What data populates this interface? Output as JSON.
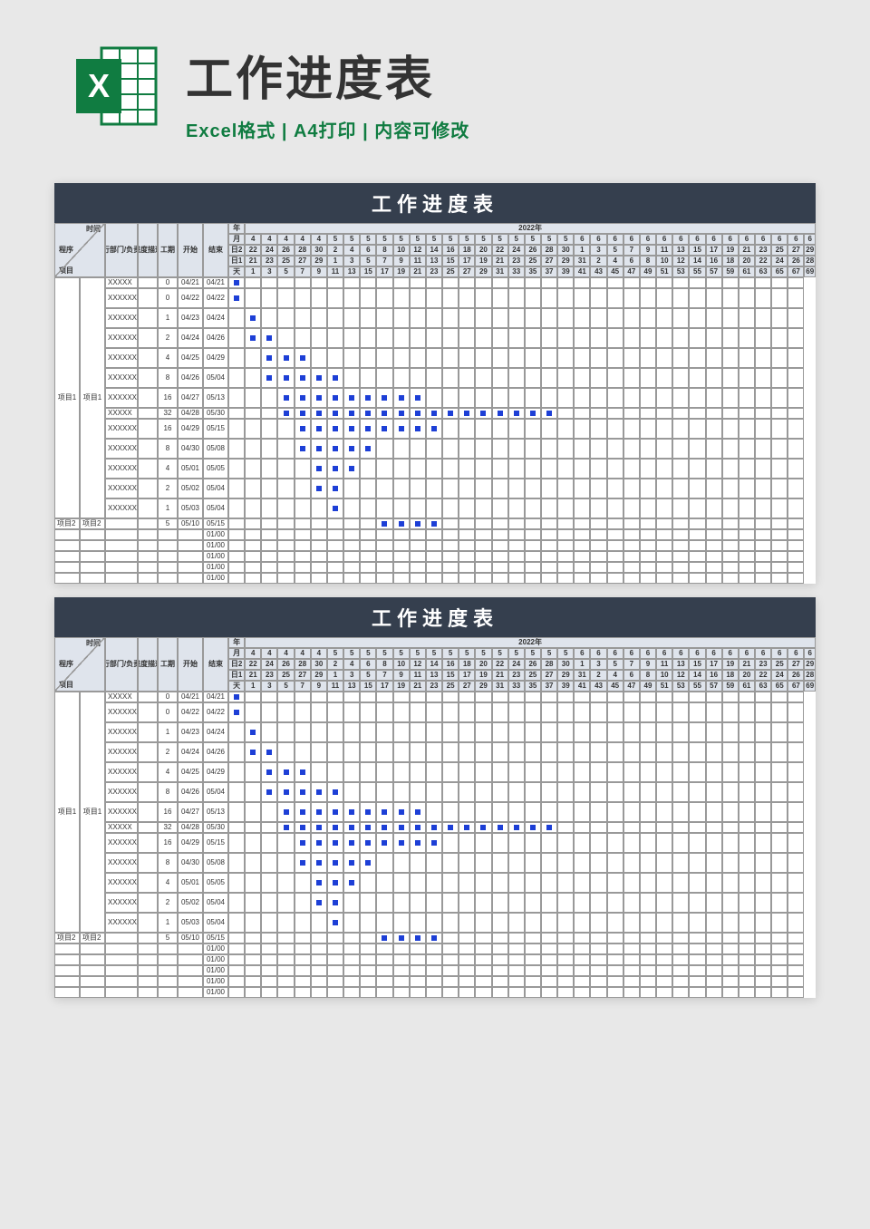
{
  "header": {
    "title": "工作进度表",
    "subtitle": "Excel格式 | A4打印 | 内容可修改"
  },
  "sheet": {
    "banner": "工作进度表",
    "cornerTop": "时间",
    "cornerBottom": "项目",
    "labels": {
      "process": "程序",
      "dept": "执行部门/负责人",
      "progress": "进度描述",
      "duration": "工期",
      "start": "开始",
      "end": "结束",
      "year": "年",
      "yearVal": "2022年",
      "month": "月",
      "date1": "日2",
      "date2": "日1",
      "day": "天"
    },
    "monthRow": [
      "4",
      "4",
      "4",
      "4",
      "4",
      "5",
      "5",
      "5",
      "5",
      "5",
      "5",
      "5",
      "5",
      "5",
      "5",
      "5",
      "5",
      "5",
      "5",
      "5",
      "6",
      "6",
      "6",
      "6",
      "6",
      "6",
      "6",
      "6",
      "6",
      "6",
      "6",
      "6",
      "6",
      "6",
      "6"
    ],
    "date2Row": [
      "22",
      "24",
      "26",
      "28",
      "30",
      "2",
      "4",
      "6",
      "8",
      "10",
      "12",
      "14",
      "16",
      "18",
      "20",
      "22",
      "24",
      "26",
      "28",
      "30",
      "1",
      "3",
      "5",
      "7",
      "9",
      "11",
      "13",
      "15",
      "17",
      "19",
      "21",
      "23",
      "25",
      "27",
      "29"
    ],
    "date1Row": [
      "21",
      "23",
      "25",
      "27",
      "29",
      "1",
      "3",
      "5",
      "7",
      "9",
      "11",
      "13",
      "15",
      "17",
      "19",
      "21",
      "23",
      "25",
      "27",
      "29",
      "31",
      "2",
      "4",
      "6",
      "8",
      "10",
      "12",
      "14",
      "16",
      "18",
      "20",
      "22",
      "24",
      "26",
      "28"
    ],
    "dayRow": [
      "1",
      "3",
      "5",
      "7",
      "9",
      "11",
      "13",
      "15",
      "17",
      "19",
      "21",
      "23",
      "25",
      "27",
      "29",
      "31",
      "33",
      "35",
      "37",
      "39",
      "41",
      "43",
      "45",
      "47",
      "49",
      "51",
      "53",
      "55",
      "57",
      "59",
      "61",
      "63",
      "65",
      "67",
      "69"
    ],
    "rows": [
      {
        "proc": "",
        "proj": "",
        "dept": "XXXXX",
        "dur": "0",
        "start": "04/21",
        "end": "04/21",
        "bars": [
          0
        ]
      },
      {
        "proc": "",
        "proj": "",
        "dept": "XXXXXX",
        "dur": "0",
        "start": "04/22",
        "end": "04/22",
        "bars": [
          0
        ]
      },
      {
        "proc": "",
        "proj": "",
        "dept": "XXXXXX",
        "dur": "1",
        "start": "04/23",
        "end": "04/24",
        "bars": [
          1
        ]
      },
      {
        "proc": "",
        "proj": "",
        "dept": "XXXXXX",
        "dur": "2",
        "start": "04/24",
        "end": "04/26",
        "bars": [
          1,
          2
        ]
      },
      {
        "proc": "",
        "proj": "",
        "dept": "XXXXXX",
        "dur": "4",
        "start": "04/25",
        "end": "04/29",
        "bars": [
          2,
          3,
          4
        ]
      },
      {
        "proc": "",
        "proj": "",
        "dept": "XXXXXX",
        "dur": "8",
        "start": "04/26",
        "end": "05/04",
        "bars": [
          2,
          3,
          4,
          5,
          6
        ]
      },
      {
        "proc": "项目1",
        "proj": "项目1",
        "dept": "XXXXXX",
        "dur": "16",
        "start": "04/27",
        "end": "05/13",
        "bars": [
          3,
          4,
          5,
          6,
          7,
          8,
          9,
          10,
          11
        ]
      },
      {
        "proc": "",
        "proj": "",
        "dept": "XXXXX",
        "dur": "32",
        "start": "04/28",
        "end": "05/30",
        "bars": [
          3,
          4,
          5,
          6,
          7,
          8,
          9,
          10,
          11,
          12,
          13,
          14,
          15,
          16,
          17,
          18,
          19
        ]
      },
      {
        "proc": "",
        "proj": "",
        "dept": "XXXXXX",
        "dur": "16",
        "start": "04/29",
        "end": "05/15",
        "bars": [
          4,
          5,
          6,
          7,
          8,
          9,
          10,
          11,
          12
        ]
      },
      {
        "proc": "",
        "proj": "",
        "dept": "XXXXXX",
        "dur": "8",
        "start": "04/30",
        "end": "05/08",
        "bars": [
          4,
          5,
          6,
          7,
          8
        ]
      },
      {
        "proc": "",
        "proj": "",
        "dept": "XXXXXX",
        "dur": "4",
        "start": "05/01",
        "end": "05/05",
        "bars": [
          5,
          6,
          7
        ]
      },
      {
        "proc": "",
        "proj": "",
        "dept": "XXXXXX",
        "dur": "2",
        "start": "05/02",
        "end": "05/04",
        "bars": [
          5,
          6
        ]
      },
      {
        "proc": "",
        "proj": "",
        "dept": "XXXXXX",
        "dur": "1",
        "start": "05/03",
        "end": "05/04",
        "bars": [
          6
        ]
      },
      {
        "proc": "项目2",
        "proj": "项目2",
        "dept": "",
        "dur": "5",
        "start": "05/10",
        "end": "05/15",
        "bars": [
          9,
          10,
          11,
          12
        ]
      },
      {
        "proc": "",
        "proj": "",
        "dept": "",
        "dur": "",
        "start": "",
        "end": "01/00",
        "bars": []
      },
      {
        "proc": "",
        "proj": "",
        "dept": "",
        "dur": "",
        "start": "",
        "end": "01/00",
        "bars": []
      },
      {
        "proc": "",
        "proj": "",
        "dept": "",
        "dur": "",
        "start": "",
        "end": "01/00",
        "bars": []
      },
      {
        "proc": "",
        "proj": "",
        "dept": "",
        "dur": "",
        "start": "",
        "end": "01/00",
        "bars": []
      },
      {
        "proc": "",
        "proj": "",
        "dept": "",
        "dur": "",
        "start": "",
        "end": "01/00",
        "bars": []
      }
    ]
  },
  "chart_data": {
    "type": "table",
    "title": "工作进度表 (Gantt)",
    "year": 2022,
    "columns": [
      "程序",
      "项目",
      "执行部门/负责人",
      "进度描述",
      "工期",
      "开始",
      "结束"
    ],
    "tasks": [
      {
        "程序": "项目1",
        "项目": "项目1",
        "工期": 0,
        "开始": "04/21",
        "结束": "04/21"
      },
      {
        "程序": "项目1",
        "项目": "项目1",
        "工期": 0,
        "开始": "04/22",
        "结束": "04/22"
      },
      {
        "程序": "项目1",
        "项目": "项目1",
        "工期": 1,
        "开始": "04/23",
        "结束": "04/24"
      },
      {
        "程序": "项目1",
        "项目": "项目1",
        "工期": 2,
        "开始": "04/24",
        "结束": "04/26"
      },
      {
        "程序": "项目1",
        "项目": "项目1",
        "工期": 4,
        "开始": "04/25",
        "结束": "04/29"
      },
      {
        "程序": "项目1",
        "项目": "项目1",
        "工期": 8,
        "开始": "04/26",
        "结束": "05/04"
      },
      {
        "程序": "项目1",
        "项目": "项目1",
        "工期": 16,
        "开始": "04/27",
        "结束": "05/13"
      },
      {
        "程序": "项目1",
        "项目": "项目1",
        "工期": 32,
        "开始": "04/28",
        "结束": "05/30"
      },
      {
        "程序": "项目1",
        "项目": "项目1",
        "工期": 16,
        "开始": "04/29",
        "结束": "05/15"
      },
      {
        "程序": "项目1",
        "项目": "项目1",
        "工期": 8,
        "开始": "04/30",
        "结束": "05/08"
      },
      {
        "程序": "项目1",
        "项目": "项目1",
        "工期": 4,
        "开始": "05/01",
        "结束": "05/05"
      },
      {
        "程序": "项目1",
        "项目": "项目1",
        "工期": 2,
        "开始": "05/02",
        "结束": "05/04"
      },
      {
        "程序": "项目1",
        "项目": "项目1",
        "工期": 1,
        "开始": "05/03",
        "结束": "05/04"
      },
      {
        "程序": "项目2",
        "项目": "项目2",
        "工期": 5,
        "开始": "05/10",
        "结束": "05/15"
      }
    ]
  }
}
